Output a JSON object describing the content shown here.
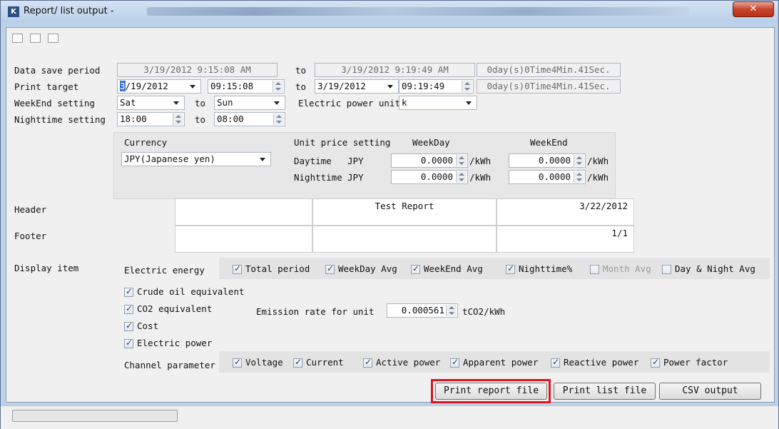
{
  "window": {
    "title": "Report/ list output -"
  },
  "period": {
    "label": "Data save period",
    "start": "3/19/2012 9:15:08 AM",
    "to": "to",
    "end": "3/19/2012 9:19:49 AM",
    "duration": "0day(s)0Time4Min.41Sec."
  },
  "print_target": {
    "label": "Print target",
    "start_date_sel": "3",
    "start_date_rest": "/19/2012",
    "start_time": "09:15:08",
    "to": "to",
    "end_date": "3/19/2012",
    "end_time": "09:19:49",
    "duration": "0day(s)0Time4Min.41Sec."
  },
  "weekend": {
    "label": "WeekEnd setting",
    "from": "Sat",
    "to_label": "to",
    "to": "Sun",
    "power_unit_label": "Electric power unit",
    "power_unit": "k"
  },
  "nighttime": {
    "label": "Nighttime setting",
    "from": "18:00",
    "to_label": "to",
    "to": "08:00"
  },
  "pricing": {
    "currency_label": "Currency",
    "currency": "JPY(Japanese yen)",
    "unit_price_label": "Unit price setting",
    "weekday_label": "WeekDay",
    "weekend_label": "WeekEnd",
    "daytime_label": "Daytime",
    "nighttime_label": "Nighttime",
    "cur_code": "JPY",
    "daytime_weekday": "0.0000",
    "daytime_weekend": "0.0000",
    "nighttime_weekday": "0.0000",
    "nighttime_weekend": "0.0000",
    "unit": "/kWh"
  },
  "header": {
    "label": "Header",
    "left": "",
    "center": "Test Report",
    "right": "3/22/2012"
  },
  "footer": {
    "label": "Footer",
    "left": "",
    "center": "",
    "right": "1/1"
  },
  "display": {
    "label": "Display item",
    "energy_label": "Electric energy",
    "total_period": "Total period",
    "weekday_avg": "WeekDay Avg",
    "weekend_avg": "WeekEnd Avg",
    "nighttime_pct": "Nighttime%",
    "month_avg": "Month Avg",
    "day_night_avg": "Day & Night Avg",
    "crude_oil": "Crude oil equivalent",
    "co2": "CO2 equivalent",
    "emission_label": "Emission rate for unit",
    "emission_value": "0.000561",
    "emission_unit": "tCO2/kWh",
    "cost": "Cost",
    "electric_power": "Electric power",
    "channel_label": "Channel parameter",
    "voltage": "Voltage",
    "current": "Current",
    "active_power": "Active power",
    "apparent_power": "Apparent power",
    "reactive_power": "Reactive power",
    "power_factor": "Power factor"
  },
  "buttons": {
    "print_report": "Print report file",
    "print_list": "Print list file",
    "csv": "CSV output"
  },
  "status": {
    "progress": 0.0
  },
  "colors": {
    "highlight": "#e0141c",
    "selection": "#3b74d4"
  }
}
